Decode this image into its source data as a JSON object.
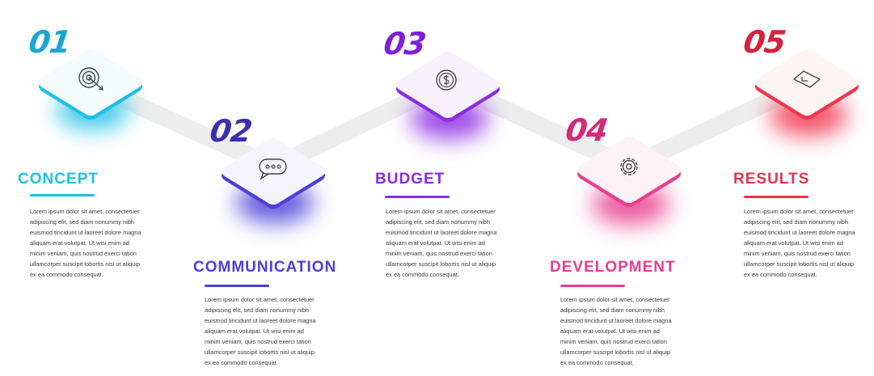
{
  "lorem": "Lorem ipsum dolor sit amet, consectetuer adipiscing elit, sed diam nonummy nibh euismod tincidunt ut laoreet dolore magna aliquam erat volutpat. Ut wisi enim ad minim veniam, quis nostrud exerci tation ullamcorper suscipit lobortis nisl ut aliquip ex ea commodo consequat.",
  "steps": [
    {
      "number": "01",
      "title": "CONCEPT",
      "icon": "target-icon",
      "color": "#1cc0e6"
    },
    {
      "number": "02",
      "title": "COMMUNICATION",
      "icon": "chat-bubble-icon",
      "color": "#4b3fd9"
    },
    {
      "number": "03",
      "title": "BUDGET",
      "icon": "dollar-coin-icon",
      "color": "#8a2be2"
    },
    {
      "number": "04",
      "title": "DEVELOPMENT",
      "icon": "gear-icon",
      "color": "#e83e8c"
    },
    {
      "number": "05",
      "title": "RESULTS",
      "icon": "checklist-icon",
      "color": "#e6334f"
    }
  ]
}
